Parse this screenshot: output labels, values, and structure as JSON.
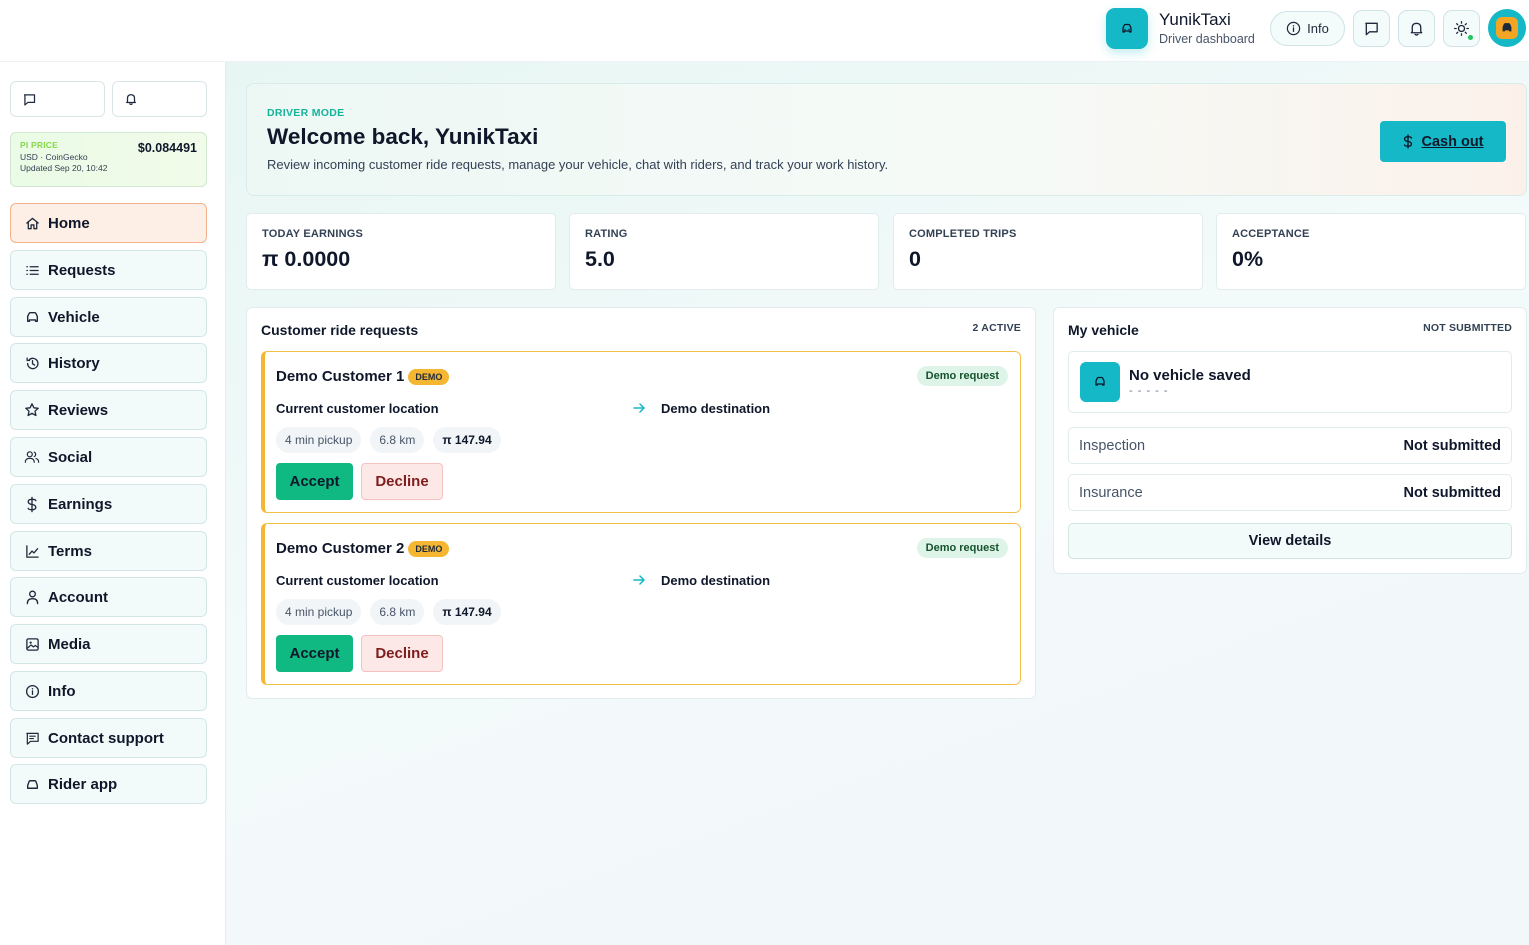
{
  "brand": {
    "name": "YunikTaxi",
    "subtitle": "Driver dashboard"
  },
  "header": {
    "info_label": "Info",
    "icons": [
      "info-icon",
      "chat-icon",
      "bell-icon",
      "sun-icon",
      "avatar"
    ]
  },
  "price": {
    "label": "PI PRICE",
    "value": "$0.084491",
    "source": "USD · CoinGecko",
    "updated": "Updated Sep 20, 10:42"
  },
  "nav": [
    {
      "label": "Home",
      "icon": "home-icon"
    },
    {
      "label": "Requests",
      "icon": "list-icon"
    },
    {
      "label": "Vehicle",
      "icon": "car-icon"
    },
    {
      "label": "History",
      "icon": "history-icon"
    },
    {
      "label": "Reviews",
      "icon": "star-icon"
    },
    {
      "label": "Social",
      "icon": "users-icon"
    },
    {
      "label": "Earnings",
      "icon": "dollar-icon"
    },
    {
      "label": "Terms",
      "icon": "chart-icon"
    },
    {
      "label": "Account",
      "icon": "user-icon"
    },
    {
      "label": "Media",
      "icon": "image-icon"
    },
    {
      "label": "Info",
      "icon": "info-icon"
    },
    {
      "label": "Contact support",
      "icon": "message-icon"
    },
    {
      "label": "Rider app",
      "icon": "car-icon"
    }
  ],
  "hero": {
    "kicker": "DRIVER MODE",
    "title": "Welcome back, YunikTaxi",
    "description": "Review incoming customer ride requests, manage your vehicle, chat with riders, and track your work history.",
    "cash_out": "Cash out"
  },
  "stats": [
    {
      "label": "TODAY EARNINGS",
      "value": "π 0.0000"
    },
    {
      "label": "RATING",
      "value": "5.0"
    },
    {
      "label": "COMPLETED TRIPS",
      "value": "0"
    },
    {
      "label": "ACCEPTANCE",
      "value": "0%"
    }
  ],
  "requests": {
    "title": "Customer ride requests",
    "meta": "2 ACTIVE",
    "items": [
      {
        "name": "Demo Customer 1",
        "badge": "DEMO",
        "tag": "Demo request",
        "from": "Current customer location",
        "to": "Demo destination",
        "pickup": "4 min pickup",
        "distance": "6.8 km",
        "fare": "π 147.94",
        "accept": "Accept",
        "decline": "Decline"
      },
      {
        "name": "Demo Customer 2",
        "badge": "DEMO",
        "tag": "Demo request",
        "from": "Current customer location",
        "to": "Demo destination",
        "pickup": "4 min pickup",
        "distance": "6.8 km",
        "fare": "π 147.94",
        "accept": "Accept",
        "decline": "Decline"
      }
    ]
  },
  "vehicle": {
    "title": "My vehicle",
    "meta": "NOT SUBMITTED",
    "name": "No vehicle saved",
    "plate": "- - - - -",
    "rows": [
      {
        "key": "Inspection",
        "value": "Not submitted"
      },
      {
        "key": "Insurance",
        "value": "Not submitted"
      }
    ],
    "view_details": "View details"
  },
  "colors": {
    "accent": "#14b8c6",
    "success": "#10b981",
    "warning": "#f5b731",
    "danger_bg": "#fde8e8",
    "active_nav": "#fdeee6"
  }
}
